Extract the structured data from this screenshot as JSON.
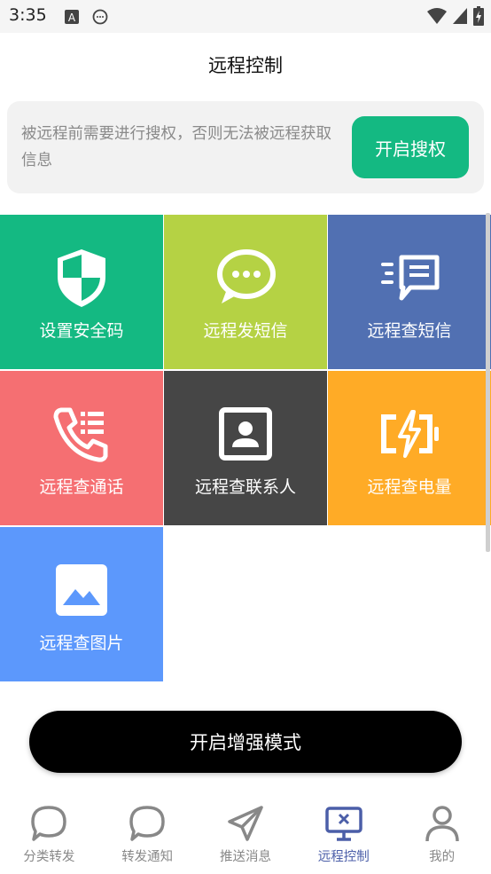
{
  "status_bar": {
    "time": "3:35",
    "icons": [
      "a-box-icon",
      "chat-bubble-icon",
      "wifi-icon",
      "signal-icon",
      "battery-charging-icon"
    ]
  },
  "header": {
    "title": "远程控制"
  },
  "auth": {
    "message": "被远程前需要进行搜权，否则无法被远程获取信息",
    "button_label": "开启搜权",
    "button_color": "#14b982"
  },
  "features": [
    {
      "label": "设置安全码",
      "icon": "shield-icon",
      "color": "#14b982"
    },
    {
      "label": "远程发短信",
      "icon": "message-bubble-icon",
      "color": "#b5d244"
    },
    {
      "label": "远程查短信",
      "icon": "message-list-icon",
      "color": "#5170b2"
    },
    {
      "label": "远程查通话",
      "icon": "phone-log-icon",
      "color": "#f56f72"
    },
    {
      "label": "远程查联系人",
      "icon": "contact-card-icon",
      "color": "#464646"
    },
    {
      "label": "远程查电量",
      "icon": "battery-charge-icon",
      "color": "#ffab26"
    },
    {
      "label": "远程查图片",
      "icon": "image-icon",
      "color": "#5c98fc"
    }
  ],
  "enhance_button": {
    "label": "开启增强模式"
  },
  "bottom_nav": {
    "items": [
      {
        "label": "分类转发",
        "icon": "chat-bubble-icon",
        "active": false
      },
      {
        "label": "转发通知",
        "icon": "chat-bubble-icon",
        "active": false
      },
      {
        "label": "推送消息",
        "icon": "send-icon",
        "active": false
      },
      {
        "label": "远程控制",
        "icon": "remote-desktop-icon",
        "active": true
      },
      {
        "label": "我的",
        "icon": "person-icon",
        "active": false
      }
    ],
    "active_color": "#4b5ea8",
    "inactive_color": "#888888"
  }
}
